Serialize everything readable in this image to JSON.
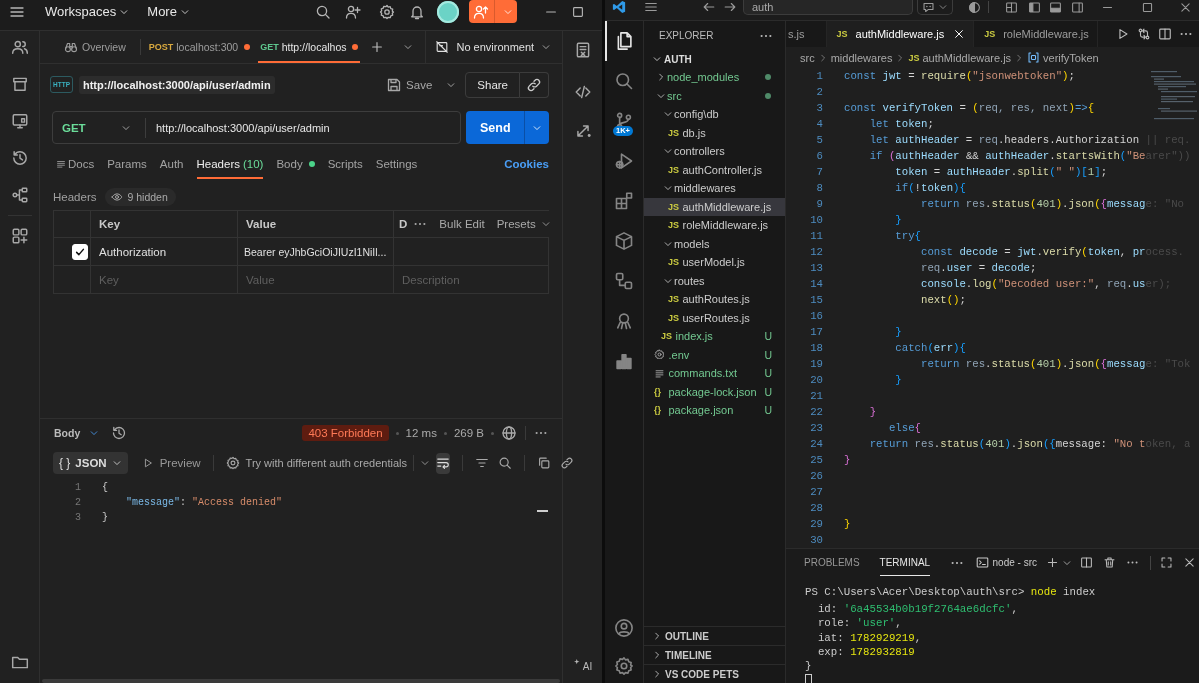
{
  "postman": {
    "top_bar": {
      "menus": [
        {
          "label": "Workspaces"
        },
        {
          "label": "More"
        }
      ]
    },
    "tabs": [
      {
        "kind": "overview",
        "label": "Overview",
        "selected": false,
        "unsaved": false
      },
      {
        "kind": "request",
        "method": "POST",
        "color": "#d9a93e",
        "label": "localhost:300",
        "selected": false,
        "unsaved": true
      },
      {
        "kind": "request",
        "method": "GET",
        "color": "#5fc88f",
        "label": "http://localhos",
        "selected": true,
        "unsaved": true
      }
    ],
    "environment": "No environment",
    "request": {
      "icon_text": "HTTP",
      "name": "http://localhost:3000/api/user/admin",
      "save": "Save",
      "share": "Share",
      "method": "GET",
      "url": "http://localhost:3000/api/user/admin",
      "send": "Send"
    },
    "request_tabs": [
      {
        "label": "Docs",
        "selected": false,
        "dot": false
      },
      {
        "label": "Params",
        "selected": false,
        "dot": false
      },
      {
        "label": "Auth",
        "selected": false,
        "dot": false
      },
      {
        "label": "Headers",
        "count": "(10)",
        "selected": true,
        "dot": false
      },
      {
        "label": "Body",
        "selected": false,
        "dot": true
      },
      {
        "label": "Scripts",
        "selected": false,
        "dot": false
      },
      {
        "label": "Settings",
        "selected": false,
        "dot": false
      }
    ],
    "cookies": "Cookies",
    "headers": {
      "title": "Headers",
      "hidden": "9 hidden",
      "columns": [
        "Key",
        "Value",
        "D"
      ],
      "bulk_edit": "Bulk Edit",
      "presets": "Presets",
      "rows": [
        {
          "checked": true,
          "key": "Authorization",
          "value": "Bearer eyJhbGciOiJIUzI1NiIl..."
        }
      ],
      "new_row": [
        {
          "placeholder": "Key"
        },
        {
          "placeholder": "Value"
        },
        {
          "placeholder": "Description"
        }
      ]
    },
    "response": {
      "view": "Body",
      "status": "403 Forbidden",
      "time": "12 ms",
      "size": "269 B",
      "format_icon": "{ }",
      "format": "JSON",
      "preview": "Preview",
      "try_auth": "Try with different auth credentials",
      "wrap_lines": true,
      "lines": [
        {
          "number": "1",
          "tokens": [
            {
              "kind": "punct",
              "text": "{"
            }
          ]
        },
        {
          "number": "2",
          "tokens": [
            {
              "kind": "key",
              "text": "    \"message\""
            },
            {
              "kind": "punct",
              "text": ": "
            },
            {
              "kind": "string",
              "text": "\"Access denied\""
            }
          ]
        },
        {
          "number": "3",
          "tokens": [
            {
              "kind": "punct",
              "text": "}"
            }
          ]
        }
      ]
    },
    "ai": "AI"
  },
  "vscode": {
    "title_bar": {
      "search": "auth"
    },
    "activity_bar": [
      {
        "selected": true
      },
      {
        "selected": false
      },
      {
        "selected": false,
        "badge": "1K+"
      },
      {
        "selected": false
      },
      {
        "selected": false
      },
      {
        "selected": false
      },
      {
        "selected": false
      },
      {
        "selected": false
      },
      {
        "selected": false
      }
    ],
    "explorer": {
      "title": "EXPLORER",
      "root": {
        "label": "AUTH",
        "expanded": true
      },
      "tree": [
        {
          "kind": "folder",
          "label": "node_modules",
          "expanded": false,
          "selected": false,
          "untracked": true,
          "dot": true
        },
        {
          "kind": "folder",
          "label": "src",
          "expanded": true,
          "selected": false,
          "untracked": true,
          "dot": true,
          "children": [
            {
              "kind": "folder",
              "label": "config\\db",
              "expanded": true,
              "selected": false,
              "untracked": false,
              "dot": false,
              "children": [
                {
                  "kind": "file",
                  "icon": "JS",
                  "label": "db.js",
                  "selected": false,
                  "untracked": false,
                  "dot": false
                }
              ]
            },
            {
              "kind": "folder",
              "label": "controllers",
              "expanded": true,
              "selected": false,
              "untracked": false,
              "dot": false,
              "children": [
                {
                  "kind": "file",
                  "icon": "JS",
                  "label": "authController.js",
                  "selected": false,
                  "untracked": false,
                  "dot": false
                }
              ]
            },
            {
              "kind": "folder",
              "label": "middlewares",
              "expanded": true,
              "selected": false,
              "untracked": false,
              "dot": false,
              "children": [
                {
                  "kind": "file",
                  "icon": "JS",
                  "label": "authMiddleware.js",
                  "selected": true,
                  "untracked": false,
                  "dot": false
                },
                {
                  "kind": "file",
                  "icon": "JS",
                  "label": "roleMiddleware.js",
                  "selected": false,
                  "untracked": false,
                  "dot": false
                }
              ]
            },
            {
              "kind": "folder",
              "label": "models",
              "expanded": true,
              "selected": false,
              "untracked": false,
              "dot": false,
              "children": [
                {
                  "kind": "file",
                  "icon": "JS",
                  "label": "userModel.js",
                  "selected": false,
                  "untracked": false,
                  "dot": false
                }
              ]
            },
            {
              "kind": "folder",
              "label": "routes",
              "expanded": true,
              "selected": false,
              "untracked": false,
              "dot": false,
              "children": [
                {
                  "kind": "file",
                  "icon": "JS",
                  "label": "authRoutes.js",
                  "selected": false,
                  "untracked": false,
                  "dot": false
                },
                {
                  "kind": "file",
                  "icon": "JS",
                  "label": "userRoutes.js",
                  "selected": false,
                  "untracked": false,
                  "dot": false
                }
              ]
            },
            {
              "kind": "file",
              "icon": "JS",
              "label": "index.js",
              "selected": false,
              "untracked": true,
              "dot": false,
              "badge": "U"
            }
          ]
        },
        {
          "kind": "env",
          "label": ".env",
          "selected": false,
          "untracked": true,
          "dot": false,
          "badge": "U"
        },
        {
          "kind": "text",
          "label": "commands.txt",
          "selected": false,
          "untracked": true,
          "dot": false,
          "badge": "U"
        },
        {
          "kind": "file",
          "icon": "{}",
          "label": "package-lock.json",
          "selected": false,
          "untracked": true,
          "dot": false,
          "badge": "U"
        },
        {
          "kind": "file",
          "icon": "{}",
          "label": "package.json",
          "selected": false,
          "untracked": true,
          "dot": false,
          "badge": "U"
        }
      ],
      "sections": [
        {
          "label": "OUTLINE",
          "expanded": false
        },
        {
          "label": "TIMELINE",
          "expanded": false
        },
        {
          "label": "VS CODE PETS",
          "expanded": false
        }
      ]
    },
    "editor": {
      "tabs": [
        {
          "label": "s.js",
          "selected": false
        },
        {
          "icon": "JS",
          "label": "authMiddleware.js",
          "selected": true
        },
        {
          "icon": "JS",
          "label": "roleMiddleware.js",
          "selected": false
        }
      ],
      "breadcrumb": [
        {
          "kind": "folder",
          "label": "src"
        },
        {
          "kind": "folder",
          "label": "middlewares"
        },
        {
          "kind": "file",
          "icon": "JS",
          "label": "authMiddleware.js"
        },
        {
          "kind": "symbol",
          "label": "verifyToken"
        }
      ],
      "lines": [
        {
          "number": "1",
          "tokens": [
            {
              "kind": "keyword",
              "text": "const "
            },
            {
              "kind": "variable",
              "text": "jwt"
            },
            {
              "kind": "text",
              "text": " = "
            },
            {
              "kind": "function",
              "text": "require"
            },
            {
              "kind": "bracket1",
              "text": "("
            },
            {
              "kind": "string",
              "text": "\"jsonwebtoken\""
            },
            {
              "kind": "bracket1",
              "text": ")"
            },
            {
              "kind": "text",
              "text": ";"
            }
          ]
        },
        {
          "number": "2"
        },
        {
          "number": "3",
          "tokens": [
            {
              "kind": "keyword",
              "text": "const "
            },
            {
              "kind": "variable",
              "text": "verifyToken"
            },
            {
              "kind": "text",
              "text": " = "
            },
            {
              "kind": "bracket1",
              "text": "("
            },
            {
              "kind": "param",
              "text": "req, res, next"
            },
            {
              "kind": "bracket1",
              "text": ")"
            },
            {
              "kind": "keyword",
              "text": "=>"
            },
            {
              "kind": "bracket1",
              "text": "{"
            }
          ]
        },
        {
          "number": "4",
          "tokens": [
            {
              "kind": "keyword",
              "text": "    let "
            },
            {
              "kind": "variable",
              "text": "token"
            },
            {
              "kind": "text",
              "text": ";"
            }
          ]
        },
        {
          "number": "5",
          "tokens": [
            {
              "kind": "keyword",
              "text": "    let "
            },
            {
              "kind": "variable",
              "text": "authHeader"
            },
            {
              "kind": "text",
              "text": " = "
            },
            {
              "kind": "param",
              "text": "req"
            },
            {
              "kind": "text",
              "text": ".headers.Authorization"
            },
            {
              "kind": "faded",
              "text": " || req."
            }
          ]
        },
        {
          "number": "6",
          "tokens": [
            {
              "kind": "keyword",
              "text": "    if "
            },
            {
              "kind": "bracket2",
              "text": "("
            },
            {
              "kind": "variable",
              "text": "authHeader"
            },
            {
              "kind": "text",
              "text": " && "
            },
            {
              "kind": "variable",
              "text": "authHeader"
            },
            {
              "kind": "text",
              "text": "."
            },
            {
              "kind": "function",
              "text": "startsWith"
            },
            {
              "kind": "bracket3",
              "text": "("
            },
            {
              "kind": "string",
              "text": "\"Be"
            },
            {
              "kind": "faded",
              "text": "arer\"))"
            }
          ]
        },
        {
          "number": "7",
          "tokens": [
            {
              "kind": "variable",
              "text": "        token"
            },
            {
              "kind": "text",
              "text": " = "
            },
            {
              "kind": "variable",
              "text": "authHeader"
            },
            {
              "kind": "text",
              "text": "."
            },
            {
              "kind": "function",
              "text": "split"
            },
            {
              "kind": "bracket3",
              "text": "("
            },
            {
              "kind": "string",
              "text": "\" \""
            },
            {
              "kind": "bracket3",
              "text": ")["
            },
            {
              "kind": "number",
              "text": "1"
            },
            {
              "kind": "bracket3",
              "text": "]"
            },
            {
              "kind": "text",
              "text": ";"
            }
          ]
        },
        {
          "number": "8",
          "tokens": [
            {
              "kind": "keyword",
              "text": "        if"
            },
            {
              "kind": "bracket3",
              "text": "("
            },
            {
              "kind": "text",
              "text": "!"
            },
            {
              "kind": "variable",
              "text": "token"
            },
            {
              "kind": "bracket3",
              "text": "){"
            }
          ]
        },
        {
          "number": "9",
          "tokens": [
            {
              "kind": "keyword",
              "text": "            return "
            },
            {
              "kind": "param",
              "text": "res"
            },
            {
              "kind": "text",
              "text": "."
            },
            {
              "kind": "function",
              "text": "status"
            },
            {
              "kind": "bracket1",
              "text": "("
            },
            {
              "kind": "number",
              "text": "401"
            },
            {
              "kind": "bracket1",
              "text": ")"
            },
            {
              "kind": "text",
              "text": "."
            },
            {
              "kind": "function",
              "text": "json"
            },
            {
              "kind": "bracket1",
              "text": "("
            },
            {
              "kind": "bracket2",
              "text": "{"
            },
            {
              "kind": "variable",
              "text": "messag"
            },
            {
              "kind": "faded",
              "text": "e: \"No"
            }
          ]
        },
        {
          "number": "10",
          "tokens": [
            {
              "kind": "bracket3",
              "text": "        }"
            }
          ]
        },
        {
          "number": "11",
          "tokens": [
            {
              "kind": "keyword",
              "text": "        try"
            },
            {
              "kind": "bracket3",
              "text": "{"
            }
          ]
        },
        {
          "number": "12",
          "tokens": [
            {
              "kind": "keyword",
              "text": "            const "
            },
            {
              "kind": "variable",
              "text": "decode"
            },
            {
              "kind": "text",
              "text": " = "
            },
            {
              "kind": "variable",
              "text": "jwt"
            },
            {
              "kind": "text",
              "text": "."
            },
            {
              "kind": "function",
              "text": "verify"
            },
            {
              "kind": "bracket1",
              "text": "("
            },
            {
              "kind": "variable",
              "text": "token"
            },
            {
              "kind": "text",
              "text": ", "
            },
            {
              "kind": "variable",
              "text": "pr"
            },
            {
              "kind": "faded",
              "text": "ocess."
            }
          ]
        },
        {
          "number": "13",
          "tokens": [
            {
              "kind": "param",
              "text": "            req"
            },
            {
              "kind": "text",
              "text": "."
            },
            {
              "kind": "variable",
              "text": "user"
            },
            {
              "kind": "text",
              "text": " = "
            },
            {
              "kind": "variable",
              "text": "decode"
            },
            {
              "kind": "text",
              "text": ";"
            }
          ]
        },
        {
          "number": "14",
          "tokens": [
            {
              "kind": "variable",
              "text": "            console"
            },
            {
              "kind": "text",
              "text": "."
            },
            {
              "kind": "function",
              "text": "log"
            },
            {
              "kind": "bracket1",
              "text": "("
            },
            {
              "kind": "string",
              "text": "\"Decoded user:\""
            },
            {
              "kind": "text",
              "text": ", "
            },
            {
              "kind": "param",
              "text": "req"
            },
            {
              "kind": "text",
              "text": "."
            },
            {
              "kind": "variable",
              "text": "us"
            },
            {
              "kind": "faded",
              "text": "er);"
            }
          ]
        },
        {
          "number": "15",
          "tokens": [
            {
              "kind": "function",
              "text": "            next"
            },
            {
              "kind": "bracket1",
              "text": "()"
            },
            {
              "kind": "text",
              "text": ";"
            }
          ]
        },
        {
          "number": "16"
        },
        {
          "number": "17",
          "tokens": [
            {
              "kind": "bracket3",
              "text": "        }"
            }
          ]
        },
        {
          "number": "18",
          "tokens": [
            {
              "kind": "keyword",
              "text": "        catch"
            },
            {
              "kind": "bracket3",
              "text": "("
            },
            {
              "kind": "variable",
              "text": "err"
            },
            {
              "kind": "bracket3",
              "text": "){"
            }
          ]
        },
        {
          "number": "19",
          "tokens": [
            {
              "kind": "keyword",
              "text": "            return "
            },
            {
              "kind": "param",
              "text": "res"
            },
            {
              "kind": "text",
              "text": "."
            },
            {
              "kind": "function",
              "text": "status"
            },
            {
              "kind": "bracket1",
              "text": "("
            },
            {
              "kind": "number",
              "text": "401"
            },
            {
              "kind": "bracket1",
              "text": ")"
            },
            {
              "kind": "text",
              "text": "."
            },
            {
              "kind": "function",
              "text": "json"
            },
            {
              "kind": "bracket1",
              "text": "("
            },
            {
              "kind": "bracket2",
              "text": "{"
            },
            {
              "kind": "variable",
              "text": "messag"
            },
            {
              "kind": "faded",
              "text": "e: \"Tok"
            }
          ]
        },
        {
          "number": "20",
          "tokens": [
            {
              "kind": "bracket3",
              "text": "        }"
            }
          ]
        },
        {
          "number": "21"
        },
        {
          "number": "22",
          "tokens": [
            {
              "kind": "bracket2",
              "text": "    }"
            }
          ]
        },
        {
          "number": "23",
          "tokens": [
            {
              "kind": "keyword",
              "text": "       else"
            },
            {
              "kind": "bracket2",
              "text": "{"
            }
          ]
        },
        {
          "number": "24",
          "tokens": [
            {
              "kind": "keyword",
              "text": "    return "
            },
            {
              "kind": "param",
              "text": "res"
            },
            {
              "kind": "text",
              "text": "."
            },
            {
              "kind": "function",
              "text": "status"
            },
            {
              "kind": "bracket3",
              "text": "("
            },
            {
              "kind": "number",
              "text": "401"
            },
            {
              "kind": "bracket3",
              "text": ")"
            },
            {
              "kind": "text",
              "text": "."
            },
            {
              "kind": "function",
              "text": "json"
            },
            {
              "kind": "bracket3",
              "text": "({"
            },
            {
              "kind": "text",
              "text": "message: "
            },
            {
              "kind": "string",
              "text": "\"No t"
            },
            {
              "kind": "faded",
              "text": "oken, a"
            }
          ]
        },
        {
          "number": "25",
          "tokens": [
            {
              "kind": "bracket2",
              "text": "}"
            }
          ]
        },
        {
          "number": "26"
        },
        {
          "number": "27"
        },
        {
          "number": "28"
        },
        {
          "number": "29",
          "tokens": [
            {
              "kind": "bracket1",
              "text": "}"
            }
          ]
        },
        {
          "number": "30"
        }
      ]
    },
    "panel": {
      "tabs": [
        {
          "label": "PROBLEMS",
          "selected": false
        },
        {
          "label": "TERMINAL",
          "selected": true
        }
      ],
      "terminal": "node - src",
      "lines": [
        {
          "tokens": [
            {
              "kind": "text",
              "text": "PS C:\\Users\\Acer\\Desktop\\auth\\src> "
            },
            {
              "kind": "command",
              "text": "node"
            },
            {
              "kind": "text",
              "text": " index"
            }
          ]
        },
        {
          "tokens": [
            {
              "kind": "text",
              "text": "  id: "
            },
            {
              "kind": "string",
              "text": "'6a45534b0b19f2764ae6dcfc'"
            },
            {
              "kind": "text",
              "text": ","
            }
          ]
        },
        {
          "tokens": [
            {
              "kind": "text",
              "text": "  role: "
            },
            {
              "kind": "string",
              "text": "'user'"
            },
            {
              "kind": "text",
              "text": ","
            }
          ]
        },
        {
          "tokens": [
            {
              "kind": "text",
              "text": "  iat: "
            },
            {
              "kind": "number",
              "text": "1782929219"
            },
            {
              "kind": "text",
              "text": ","
            }
          ]
        },
        {
          "tokens": [
            {
              "kind": "text",
              "text": "  exp: "
            },
            {
              "kind": "number",
              "text": "1782932819"
            }
          ]
        },
        {
          "tokens": [
            {
              "kind": "text",
              "text": "}"
            }
          ]
        }
      ]
    }
  }
}
